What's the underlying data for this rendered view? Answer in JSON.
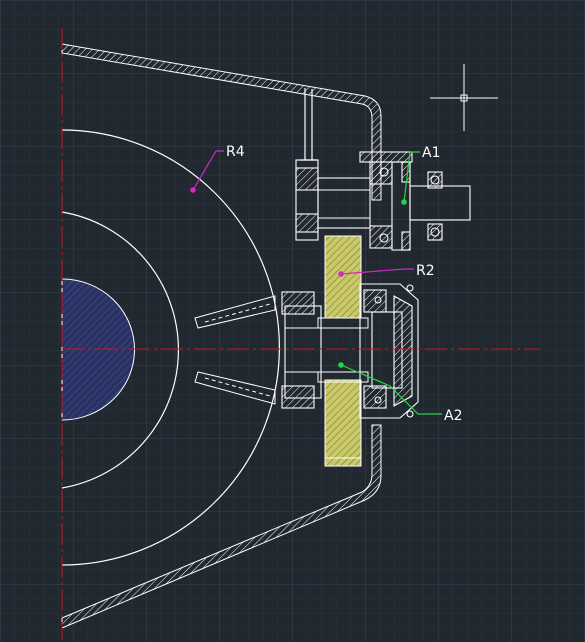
{
  "colors": {
    "background": "#212830",
    "grid_minor": "#2b333d",
    "grid_major": "#39434f",
    "line": "#ffffff",
    "center_line": "#d0141c",
    "gear_fill": "#c9c96a",
    "shaft_fill": "#2a3163",
    "leader_magenta": "#d228c8",
    "leader_green": "#2ad24a"
  },
  "icons": {
    "crosshair": "crosshair-cursor-icon"
  },
  "labels": {
    "r4": "R4",
    "a1": "A1",
    "r2": "R2",
    "a2": "A2"
  }
}
